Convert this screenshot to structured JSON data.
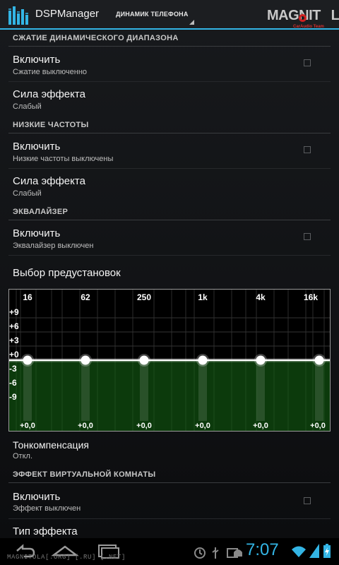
{
  "app": {
    "title": "DSPManager",
    "output_selector": "ДИНАМИК ТЕЛЕФОНА",
    "logo_text": "MAGNITOLA",
    "logo_subtitle": "CarAudio Team",
    "accent_color": "#33b5e5"
  },
  "sections": [
    {
      "header": "СЖАТИЕ ДИНАМИЧЕСКОГО ДИАПАЗОНА",
      "items": [
        {
          "title": "Включить",
          "summary": "Сжатие выключенно",
          "checked": false
        },
        {
          "title": "Сила эффекта",
          "summary": "Слабый"
        }
      ]
    },
    {
      "header": "НИЗКИЕ ЧАСТОТЫ",
      "items": [
        {
          "title": "Включить",
          "summary": "Низкие частоты выключены",
          "checked": false
        },
        {
          "title": "Сила эффекта",
          "summary": "Слабый"
        }
      ]
    },
    {
      "header": "ЭКВАЛАЙЗЕР",
      "items": [
        {
          "title": "Включить",
          "summary": "Эквалайзер выключен",
          "checked": false
        },
        {
          "title": "Выбор предустановок"
        }
      ]
    },
    {
      "items": [
        {
          "title": "Тонкомпенсация",
          "summary": "Откл."
        }
      ]
    },
    {
      "header": "ЭФФЕКТ ВИРТУАЛЬНОЙ КОМНАТЫ",
      "items": [
        {
          "title": "Включить",
          "summary": "Эффект выключен",
          "checked": false
        },
        {
          "title": "Тип эффекта"
        }
      ]
    }
  ],
  "equalizer": {
    "frequencies": [
      "16",
      "62",
      "250",
      "1k",
      "4k",
      "16k"
    ],
    "gain_labels": [
      "+9",
      "+6",
      "+3",
      "+0",
      "-3",
      "-6",
      "-9"
    ],
    "band_values": [
      "+0,0",
      "+0,0",
      "+0,0",
      "+0,0",
      "+0,0",
      "+0,0"
    ],
    "band_gains_db": [
      0,
      0,
      0,
      0,
      0,
      0
    ],
    "range_db": [
      -12,
      12
    ],
    "fill_color": "#0c3a0c"
  },
  "status_bar": {
    "time": "7:07",
    "watermark": "MAGNITOLA[.ORG] [.RU] [.NET]"
  },
  "navigation": [
    "back",
    "home",
    "recent-apps"
  ]
}
